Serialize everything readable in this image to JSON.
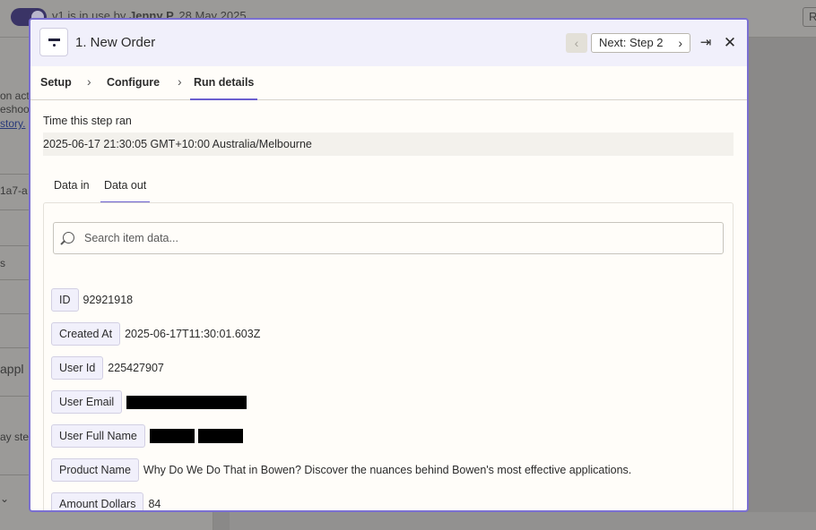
{
  "background": {
    "in_use_prefix": "v1  is in use by",
    "in_use_user": "Jenny P.",
    "in_use_date": "28 May 2025",
    "top_right_button": "R",
    "fragments": [
      "on act",
      "eshoo",
      "story.",
      "1a7-a",
      "s",
      "appl",
      "ay ste"
    ]
  },
  "modal": {
    "title": "1. New Order",
    "prev_icon": "chevron-left-icon",
    "next_label": "Next: Step 2",
    "next_icon": "chevron-right-icon",
    "expand_icon": "arrow-right-to-line-icon",
    "close_icon": "close-icon"
  },
  "steps": {
    "items": [
      "Setup",
      "Configure",
      "Run details"
    ],
    "active": "Run details"
  },
  "run": {
    "time_label": "Time this step ran",
    "time_value": "2025-06-17 21:30:05 GMT+10:00 Australia/Melbourne"
  },
  "data_tabs": {
    "items": [
      "Data in",
      "Data out"
    ],
    "active": "Data out"
  },
  "search": {
    "placeholder": "Search item data..."
  },
  "fields": [
    {
      "key": "ID",
      "value": "92921918"
    },
    {
      "key": "Created At",
      "value": "2025-06-17T11:30:01.603Z"
    },
    {
      "key": "User Id",
      "value": "225427907"
    },
    {
      "key": "User Email",
      "value": "",
      "redacted": true
    },
    {
      "key": "User Full Name",
      "value": "",
      "pixelated": true
    },
    {
      "key": "Product Name",
      "value": "Why Do We Do That in Bowen? Discover the nuances behind Bowen's most effective applications."
    },
    {
      "key": "Amount Dollars",
      "value": "84"
    }
  ],
  "colors": {
    "accent": "#6b5fcf",
    "modal_border": "#7a6fd1",
    "header_bg": "#f1f0fb"
  }
}
